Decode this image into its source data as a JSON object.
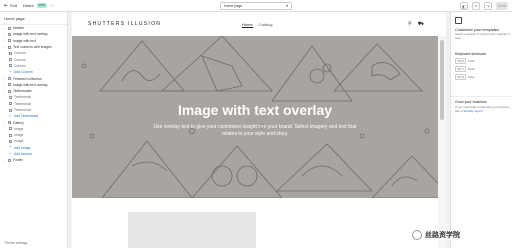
{
  "topbar": {
    "exit_label": "Exit",
    "theme_name": "Debut",
    "live_badge": "Live",
    "page_select": "Home page",
    "save_label": "Save"
  },
  "sidebar": {
    "title": "Home page",
    "items": [
      {
        "label": "Header",
        "kind": "group"
      },
      {
        "label": "Image with text overlay",
        "kind": "group"
      },
      {
        "label": "Image with text",
        "kind": "group"
      },
      {
        "label": "Text columns with images",
        "kind": "group"
      },
      {
        "label": "Column",
        "kind": "child"
      },
      {
        "label": "Column",
        "kind": "child"
      },
      {
        "label": "Column",
        "kind": "child"
      },
      {
        "label": "Add Column",
        "kind": "add"
      },
      {
        "label": "Featured collection",
        "kind": "group"
      },
      {
        "label": "Image with text overlay",
        "kind": "group"
      },
      {
        "label": "Testimonials",
        "kind": "group"
      },
      {
        "label": "Testimonial",
        "kind": "child"
      },
      {
        "label": "Testimonial",
        "kind": "child"
      },
      {
        "label": "Testimonial",
        "kind": "child"
      },
      {
        "label": "Add Testimonial",
        "kind": "add"
      },
      {
        "label": "Gallery",
        "kind": "group"
      },
      {
        "label": "Image",
        "kind": "child"
      },
      {
        "label": "Image",
        "kind": "child"
      },
      {
        "label": "Image",
        "kind": "child"
      },
      {
        "label": "Add Image",
        "kind": "add"
      },
      {
        "label": "Add section",
        "kind": "add"
      },
      {
        "label": "Footer",
        "kind": "group"
      }
    ],
    "bottom_label": "Theme settings"
  },
  "store": {
    "logo": "SHUTTERS ILLUSION",
    "nav": [
      "Home",
      "Catalog"
    ],
    "hero_title": "Image with text overlay",
    "hero_text": "Use overlay text to give your customers insight into your brand. Select imagery and text that relates to your style and story."
  },
  "right_panel": {
    "title": "Customize your templates",
    "desc": "Select a section or block in the sidebar to start.",
    "shortcuts_title": "Keyboard shortcuts",
    "shortcuts": [
      {
        "keys": "Ctrl Z",
        "label": "Undo"
      },
      {
        "keys": "Ctrl Y",
        "label": "Redo"
      },
      {
        "keys": "Ctrl S",
        "label": "Save"
      }
    ],
    "business_title": "Grow your business",
    "business_desc": "If you need help customizing your theme, hire a",
    "business_link": "Shopify expert"
  },
  "watermark": "丝路资学院",
  "colors": {
    "hero_bg": "#a8a4a1",
    "accent": "#2c6ecb",
    "badge_bg": "#aee9d1"
  }
}
